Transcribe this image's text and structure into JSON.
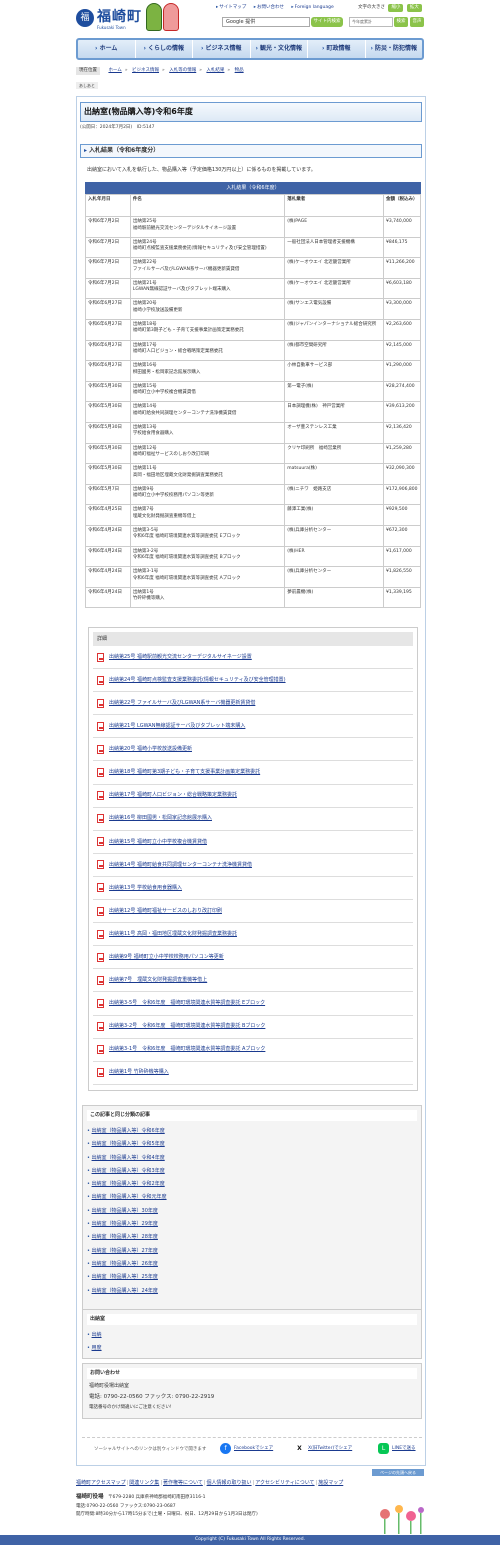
{
  "header": {
    "logo_mark": "福",
    "logo_text": "福崎町",
    "logo_sub": "Fukusaki Town",
    "top_links": [
      "サイトマップ",
      "お問い合わせ",
      "Foreign language"
    ],
    "font_size_label": "文字の大きさ",
    "font_size_small": "縮小",
    "font_size_large": "拡大",
    "search_placeholder": "Google 提供",
    "search_button": "サイト内検索",
    "access_count": "今年度累計",
    "btn1": "検索",
    "btn2": "音声"
  },
  "nav": [
    "ホーム",
    "くらしの情報",
    "ビジネス情報",
    "観光・文化情報",
    "町政情報",
    "防災・防犯情報"
  ],
  "breadcrumb": {
    "label": "現在位置",
    "items": [
      "ホーム",
      "ビジネス情報",
      "入札等の情報",
      "入札結果",
      "物品"
    ],
    "aside": "あしあと"
  },
  "page": {
    "title": "出納室(物品購入等)令和6年度",
    "published": "(公開日：2024年7月2日)　ID:5147",
    "section_title": "入札結果（令和6年度分）",
    "intro": "出納室において入札を執行した、物品購入等（予定価格130万円以上）に係るものを掲載しています。"
  },
  "table": {
    "caption": "入札結果（令和6年度）",
    "headers": [
      "入札年月日",
      "件名",
      "落札業者",
      "金額（税込み）"
    ],
    "rows": [
      [
        "令和6年7月2日",
        "出納第25号\n福崎駅前観光交流センターデジタルサイネージ設置",
        "(株)PAGE",
        "¥3,740,000"
      ],
      [
        "令和6年7月2日",
        "出納第24号\n福崎町点検監査支援業務委託(情報セキュリティ及び安全管理措置)",
        "一般社団法人日本管理者支援機構",
        "¥846,175"
      ],
      [
        "令和6年7月2日",
        "出納第22号\nファイルサーバ及びLGWAN系サーバ機器更新賃貸借",
        "(株)ケーオウエイ 北近畿営業所",
        "¥11,266,200"
      ],
      [
        "令和6年7月2日",
        "出納第21号\nLGWAN無線認証サーバ及びタブレット端末購入",
        "(株)ケーオウエイ 北近畿営業所",
        "¥6,603,180"
      ],
      [
        "令和6年6月27日",
        "出納第20号\n福崎小学校放送設備更新",
        "(株)サンエス電気設備",
        "¥3,300,000"
      ],
      [
        "令和6年6月27日",
        "出納第18号\n福崎町第3期子ども・子育て支援事業計画策定業務委託",
        "(株)ジャパンインターナショナル総合研究所",
        "¥2,263,600"
      ],
      [
        "令和6年6月27日",
        "出納第17号\n福崎町人口ビジョン・総合戦略策定業務委託",
        "(株)都市空間研究所",
        "¥2,145,000"
      ],
      [
        "令和6年6月27日",
        "出納第16号\n柳田國男・松岡家記念館展示購入",
        "小林自動車サービス部",
        "¥1,290,000"
      ],
      [
        "令和6年5月30日",
        "出納第15号\n福崎町立小中学校複合機賃貸借",
        "第一電子(株)",
        "¥28,274,400"
      ],
      [
        "令和6年5月30日",
        "出納第14号\n福崎町給食共同調理センターコンテナ洗浄機賃貸借",
        "日本調理機(株)　神戸営業所",
        "¥39,613,200"
      ],
      [
        "令和6年5月30日",
        "出納第13号\n学校給食用食器購入",
        "オーザ豊ステンレス工業",
        "¥2,136,420"
      ],
      [
        "令和6年5月30日",
        "出納第12号\n福崎町福祉サービスのしおり改訂印刷",
        "クリヤ印刷所　福崎営業所",
        "¥1,259,280"
      ],
      [
        "令和6年5月30日",
        "出納第11号\n高岡・福田地区埋蔵文化財発掘調査業務委託",
        "matsuura(株)",
        "¥32,090,300"
      ],
      [
        "令和6年5月7日",
        "出納第9号\n福崎町立小中学校校務用パソコン等更新",
        "(株)ニチワ　姫路支店",
        "¥172,906,800"
      ],
      [
        "令和6年4月25日",
        "出納第7号\n埋蔵文化財発掘調査重機等借上",
        "藤澤工業(株)",
        "¥929,500"
      ],
      [
        "令和6年4月24日",
        "出納第3-5号\n令和6年度 福崎町環境関連水質等調査委託 Eブロック",
        "(株)兵庫分析センター",
        "¥672,300"
      ],
      [
        "令和6年4月24日",
        "出納第3-2号\n令和6年度 福崎町環境関連水質等調査委託 Bブロック",
        "(株)HER",
        "¥1,617,000"
      ],
      [
        "令和6年4月24日",
        "出納第3-1号\n令和6年度 福崎町環境関連水質等調査委託 Aブロック",
        "(株)兵庫分析センター",
        "¥1,826,550"
      ],
      [
        "令和6年4月24日",
        "出納第1号\n竹砕砕機等購入",
        "夢前農機(株)",
        "¥1,339,195"
      ]
    ]
  },
  "details": {
    "title": "詳細",
    "items": [
      "出納第25号 福崎駅前観光交流センターデジタルサイネージ設置",
      "出納第24号 福崎町点検監査支援業務委託(情報セキュリティ及び安全管理措置)",
      "出納第22号 ファイルサーバ及びLGWAN系サーバ機器更新賃貸借",
      "出納第21号 LGWAN無線認証サーバ及びタブレット端末購入",
      "出納第20号 福崎小学校放送設備更新",
      "出納第18号 福崎町第3期子ども・子育て支援事業計画策定業務委託",
      "出納第17号 福崎町人口ビジョン・総合戦略策定業務委託",
      "出納第16号 柳田國男・松岡家記念館展示購入",
      "出納第15号 福崎町立小中学校複合機賃貸借",
      "出納第14号 福崎町給食共同調理センターコンテナ洗浄機賃貸借",
      "出納第13号 学校給食用食器購入",
      "出納第12号 福崎町福祉サービスのしおり改訂印刷",
      "出納第11号 高岡・福田地区埋蔵文化財発掘調査業務委託",
      "出納第9号 福崎町立小中学校校務用パソコン等更新",
      "出納第7号　埋蔵文化財発掘調査重機等借上",
      "出納第3-5号　令和6年度　福崎町環境関連水質等調査委託 Eブロック",
      "出納第3-2号　令和6年度　福崎町環境関連水質等調査委託 Bブロック",
      "出納第3-1号　令和6年度　福崎町環境関連水質等調査委託 Aブロック",
      "出納第1号 竹砕砕機等購入"
    ]
  },
  "related": {
    "title": "この記事と同じ分類の記事",
    "items": [
      "出納室（物品購入等）令和6年度",
      "出納室（物品購入等）令和5年度",
      "出納室（物品購入等）令和4年度",
      "出納室（物品購入等）令和3年度",
      "出納室（物品購入等）令和2年度",
      "出納室（物品購入等）令和元年度",
      "出納室（物品購入等）30年度",
      "出納室（物品購入等）29年度",
      "出納室（物品購入等）28年度",
      "出納室（物品購入等）27年度",
      "出納室（物品購入等）26年度",
      "出納室（物品購入等）25年度",
      "出納室（物品購入等）24年度"
    ]
  },
  "dept": {
    "title": "出納室",
    "items": [
      "出納",
      "用度"
    ]
  },
  "inquiry": {
    "title": "お問い合わせ",
    "org": "福崎町役場出納室",
    "phone": "電話: 0790-22-0560 ファックス: 0790-22-2919",
    "note": "電話番号のかけ間違いにご注意ください!"
  },
  "share": {
    "text": "ソーシャルサイトへのリンクは別ウィンドウで開きます",
    "facebook": "Facebookでシェア",
    "x": "X(旧Twitter)でシェア",
    "line": "LINEで送る"
  },
  "footer": {
    "page_top": "ページの先頭へ戻る",
    "links": [
      "福崎町アクセスマップ",
      "関連リンク集",
      "著作権等について",
      "個人情報の取り扱い",
      "アクセシビリティについて",
      "施設マップ"
    ],
    "org_name": "福崎町役場",
    "address": "〒679-2280 兵庫県神崎郡福崎町南田原3116-1",
    "tel": "電話:0790-22-0560 ファックス:0790-23-0687",
    "hours": "開庁時間:8時30分から17時15分まで(土曜・日曜日、祝日、12月29日から1月3日は閉庁)",
    "copyright": "Copyright (C) Fukusaki Town All Rights Reserved."
  },
  "colors": {
    "brand": "#1e4d9e",
    "nav_border": "#6c9bd1",
    "table_caption": "#3f63a6",
    "button_green": "#8bc34a",
    "pdf_red": "#dd3333"
  }
}
